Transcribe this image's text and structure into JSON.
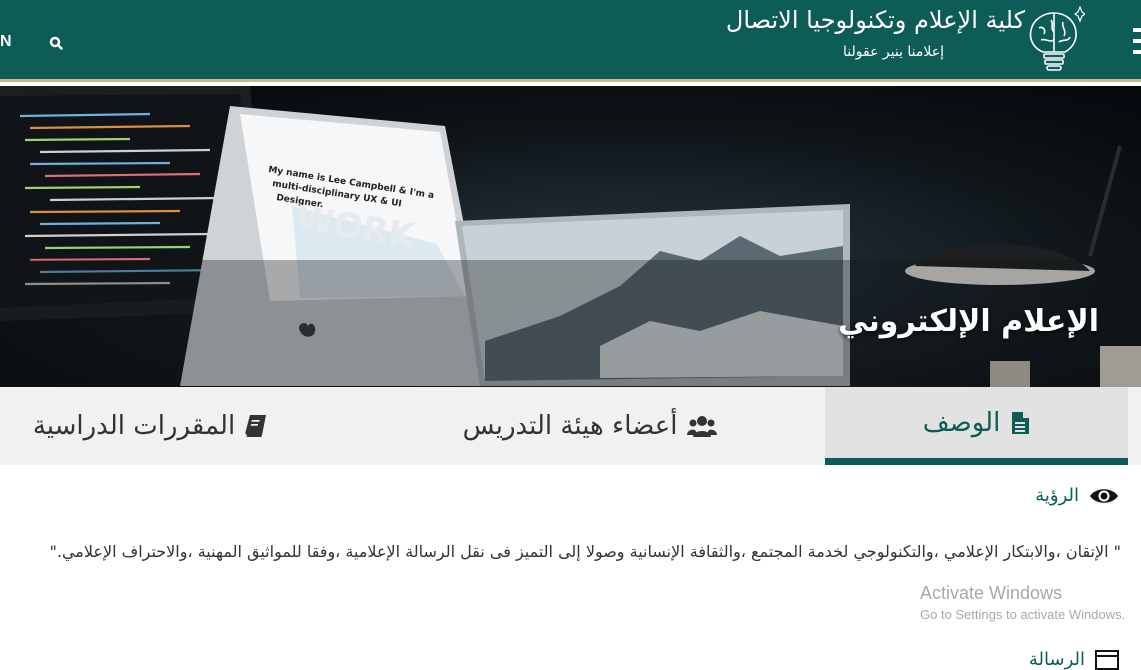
{
  "header": {
    "language_toggle": "N",
    "college_name": "كلية الإعلام وتكنولوجيا الاتصال",
    "slogan": "إعلامنا ينير عقولنا"
  },
  "hero": {
    "department_title": "الإعلام الإلكتروني",
    "screen_text": "My name is Lee Campbell & I'm a multi-disciplinary UX & UI Designer.",
    "screen_word": "WORK"
  },
  "tabs": [
    {
      "label": "الوصف",
      "icon": "file-text-icon",
      "active": true
    },
    {
      "label": "أعضاء هيئة التدريس",
      "icon": "users-icon",
      "active": false
    },
    {
      "label": "المقررات الدراسية",
      "icon": "book-icon",
      "active": false
    }
  ],
  "content": {
    "vision_heading": "الرؤية",
    "vision_text": "\" الإتقان ،والابتكار الإعلامي ،والتكنولوجي لخدمة المجتمع ،والثقافة الإنسانية وصولا إلى التميز فى نقل الرسالة الإعلامية ،وفقا للمواثيق المهنية ،والاحتراف الإعلامي.\"",
    "next_heading": "الرسالة"
  },
  "watermark": {
    "title": "Activate Windows",
    "subtitle": "Go to Settings to activate Windows."
  },
  "colors": {
    "brand": "#0d5c56",
    "accent_border": "#c9b98a",
    "tab_bg": "#f1f1f1"
  }
}
